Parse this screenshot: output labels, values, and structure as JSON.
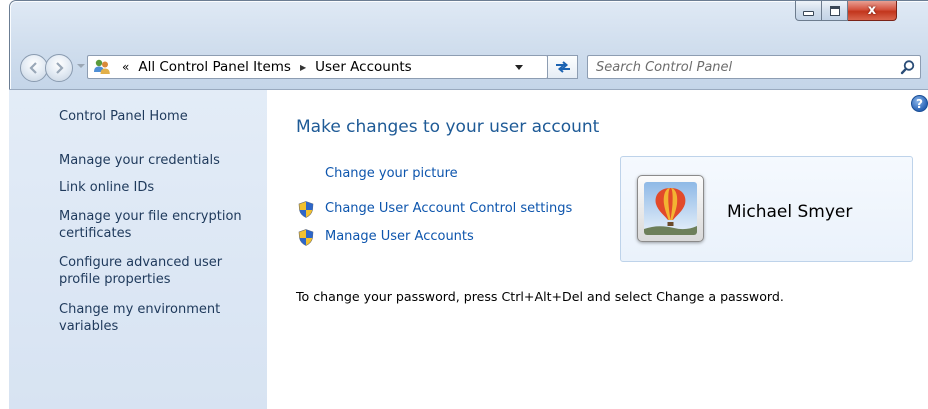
{
  "window": {
    "minimize_label": "",
    "maximize_label": "",
    "close_label": "x"
  },
  "address_bar": {
    "overflow_chevron": "«",
    "crumbs": [
      "All Control Panel Items",
      "User Accounts"
    ]
  },
  "search": {
    "placeholder": "Search Control Panel"
  },
  "sidebar": {
    "items": [
      {
        "label": "Control Panel Home"
      },
      {
        "label": "Manage your credentials"
      },
      {
        "label": "Link online IDs"
      },
      {
        "label": "Manage your file encryption certificates"
      },
      {
        "label": "Configure advanced user profile properties"
      },
      {
        "label": "Change my environment variables"
      }
    ]
  },
  "main": {
    "heading": "Make changes to your user account",
    "links": [
      {
        "label": "Change your picture",
        "shield": false
      },
      {
        "label": "Change User Account Control settings",
        "shield": true
      },
      {
        "label": "Manage User Accounts",
        "shield": true
      }
    ],
    "password_hint": "To change your password, press Ctrl+Alt+Del and select Change a password."
  },
  "user": {
    "name": "Michael Smyer"
  },
  "help_icon_glyph": "?",
  "colors": {
    "link": "#0d55ad",
    "heading": "#1e5a96",
    "sidebar_link": "#1e395b",
    "close_button": "#c2351c"
  }
}
